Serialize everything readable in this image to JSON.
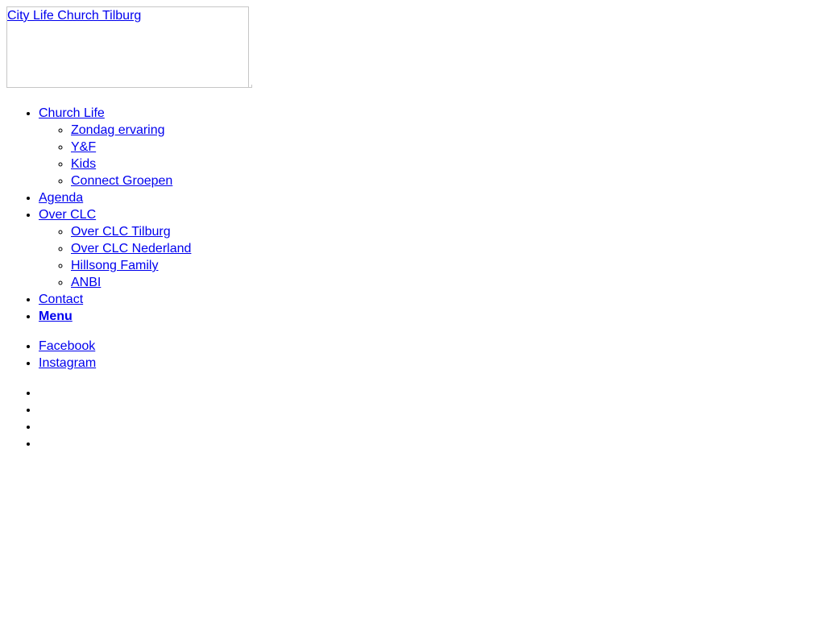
{
  "header": {
    "logo_alt": "City Life Church Tilburg"
  },
  "nav": {
    "church_life": {
      "label": "Church Life",
      "children": [
        "Zondag ervaring",
        "Y&F",
        "Kids",
        "Connect Groepen"
      ]
    },
    "agenda": "Agenda",
    "over_clc": {
      "label": "Over CLC",
      "children": [
        "Over CLC Tilburg",
        "Over CLC Nederland",
        "Hillsong Family",
        "ANBI"
      ]
    },
    "contact": "Contact",
    "menu": "Menu"
  },
  "social": {
    "facebook": "Facebook",
    "instagram": "Instagram"
  }
}
